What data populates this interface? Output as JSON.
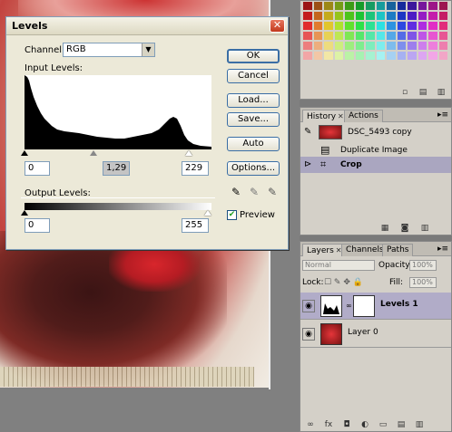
{
  "levels": {
    "title": "Levels",
    "close_glyph": "✕",
    "channel_label": "Channel:",
    "channel_value": "RGB",
    "input_levels_label": "Input Levels:",
    "input_black": "0",
    "input_gamma": "1,29",
    "input_white": "229",
    "output_levels_label": "Output Levels:",
    "output_black": "0",
    "output_white": "255",
    "buttons": {
      "ok": "OK",
      "cancel": "Cancel",
      "load": "Load...",
      "save": "Save...",
      "auto": "Auto",
      "options": "Options..."
    },
    "preview_label": "Preview",
    "preview_checked": true
  },
  "history": {
    "tabs": [
      "History",
      "Actions"
    ],
    "snapshot": "DSC_5493 copy",
    "items": [
      "Duplicate Image",
      "Crop"
    ]
  },
  "layers": {
    "tabs": [
      "Layers",
      "Channels",
      "Paths"
    ],
    "blend_mode": "Normal",
    "opacity_label": "Opacity:",
    "opacity_value": "100%",
    "lock_label": "Lock:",
    "fill_label": "Fill:",
    "fill_value": "100%",
    "items": [
      "Levels 1",
      "Layer 0"
    ]
  },
  "colors": {
    "dialog_bg": "#ece9d8",
    "accent": "#3a6ea5",
    "panel_bg": "#d4d0c8",
    "selected_row": "#b1acc8"
  }
}
